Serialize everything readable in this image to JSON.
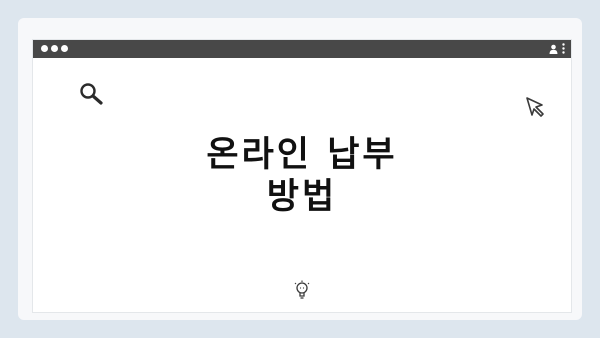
{
  "page": {
    "background": "#dde6ee",
    "card_background": "#f7f8fa"
  },
  "window": {
    "titlebar_color": "#484848",
    "traffic_dots": 3,
    "pager_dots": 4,
    "icons": [
      "search-icon",
      "user-icon",
      "kebab-icon",
      "cursor-icon",
      "lightbulb-icon"
    ]
  },
  "headline": {
    "line1": "온라인 납부",
    "line2": "방법"
  }
}
